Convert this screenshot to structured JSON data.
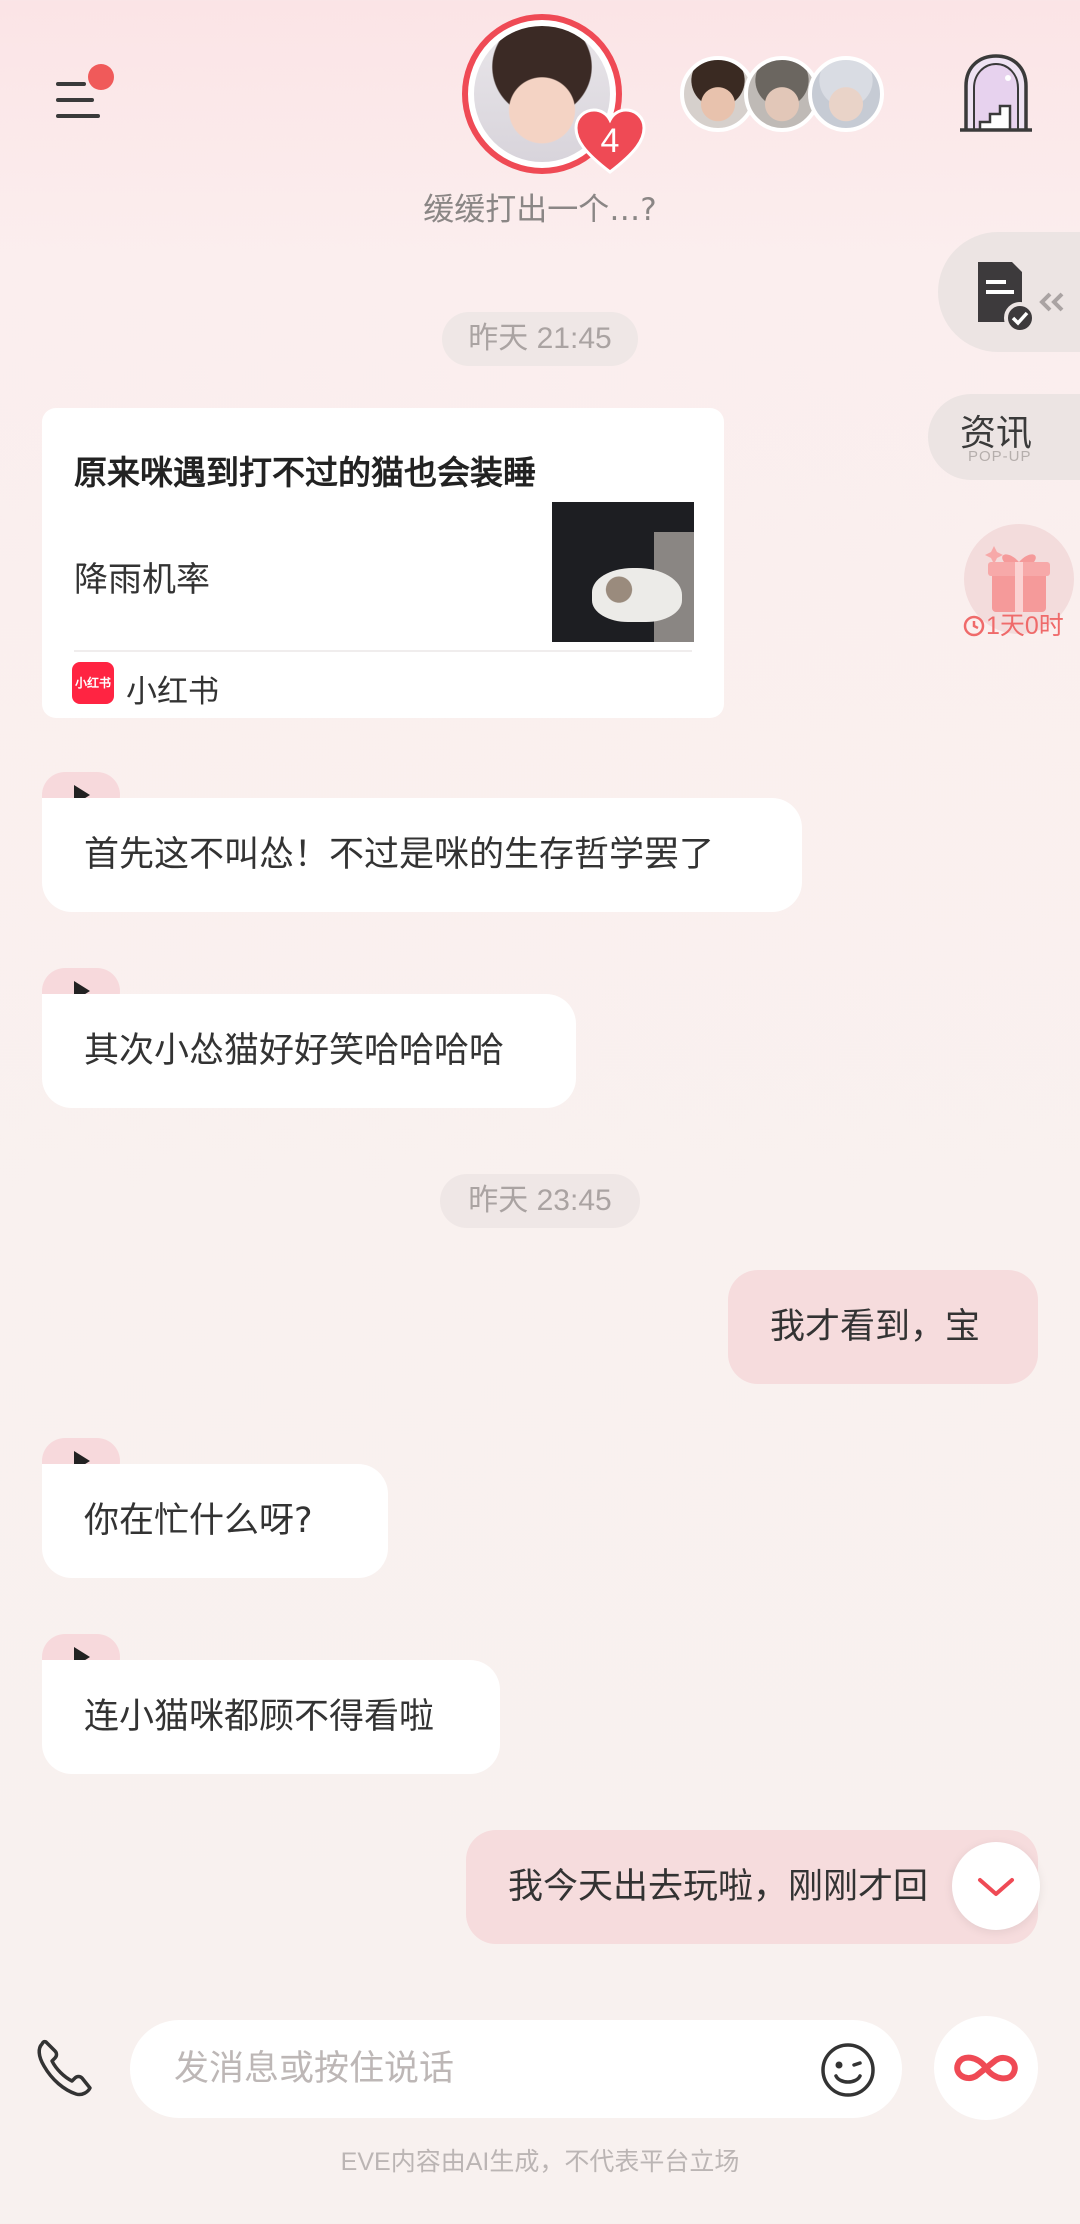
{
  "header": {
    "menu_has_notification": true,
    "main_avatar_icon": "character-avatar",
    "unread_count": "4",
    "status_text": "缓缓打出一个…?",
    "friend_avatars": [
      "friend-avatar-1",
      "friend-avatar-2",
      "friend-avatar-3"
    ],
    "castle_icon": "castle-door-icon"
  },
  "side_widgets": {
    "news_label": "资讯",
    "news_sublabel": "POP-UP",
    "gift_timer": "1天0时"
  },
  "messages": {
    "ts1": "昨天 21:45",
    "card": {
      "title": "原来咪遇到打不过的猫也会装睡",
      "description": "降雨机率",
      "logo_text": "小红书",
      "source": "小红书"
    },
    "m1": "首先这不叫怂！不过是咪的生存哲学罢了",
    "m2": "其次小怂猫好好笑哈哈哈哈",
    "ts2": "昨天 23:45",
    "m3": "我才看到，宝",
    "m4": "你在忙什么呀?",
    "m5": "连小猫咪都顾不得看啦",
    "m6": "我今天出去玩啦，刚刚才回"
  },
  "input": {
    "placeholder": "发消息或按住说话"
  },
  "footer": {
    "disclaimer": "EVE内容由AI生成，不代表平台立场"
  },
  "colors": {
    "accent": "#ef4a55",
    "bubble_out": "#f6dcdd",
    "bubble_in": "#ffffff"
  }
}
